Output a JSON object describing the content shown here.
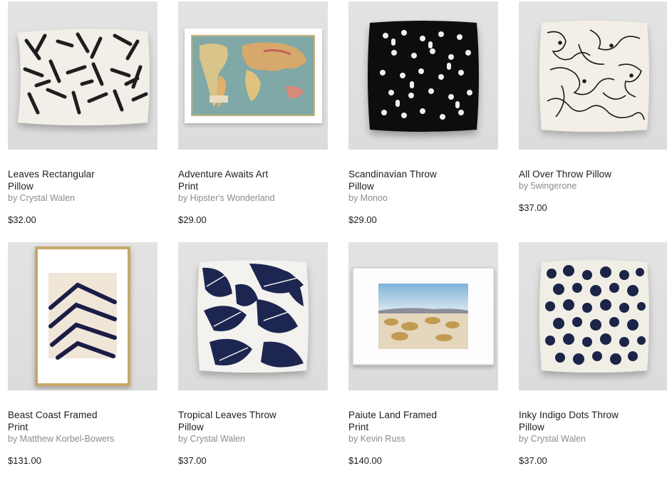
{
  "products": [
    {
      "title": "Leaves Rectangular Pillow",
      "artist": "by Crystal Walen",
      "price": "$32.00",
      "image": "black-leaves-rectangular-pillow"
    },
    {
      "title": "Adventure Awaits Art Print",
      "artist": "by Hipster's Wonderland",
      "price": "$29.00",
      "image": "vintage-world-map-print"
    },
    {
      "title": "Scandinavian Throw Pillow",
      "artist": "by Monoo",
      "price": "$29.00",
      "image": "black-pillow-white-motifs"
    },
    {
      "title": "All Over Throw Pillow",
      "artist": "by 5wingerone",
      "price": "$37.00",
      "image": "line-faces-pillow"
    },
    {
      "title": "Beast Coast Framed Print",
      "artist": "by Matthew Korbel-Bowers",
      "price": "$131.00",
      "image": "navy-chevron-framed-print"
    },
    {
      "title": "Tropical Leaves Throw Pillow",
      "artist": "by Crystal Walen",
      "price": "$37.00",
      "image": "navy-tropical-leaves-pillow"
    },
    {
      "title": "Paiute Land Framed Print",
      "artist": "by Kevin Russ",
      "price": "$140.00",
      "image": "desert-landscape-framed-print"
    },
    {
      "title": "Inky Indigo Dots Throw Pillow",
      "artist": "by Crystal Walen",
      "price": "$37.00",
      "image": "indigo-dots-pillow"
    }
  ],
  "colors": {
    "thumb_bg": "#dedede",
    "title": "#1c1c1c",
    "artist": "#8c8c8c",
    "navy": "#1c2448",
    "pillow_cream": "#f1eee6"
  }
}
